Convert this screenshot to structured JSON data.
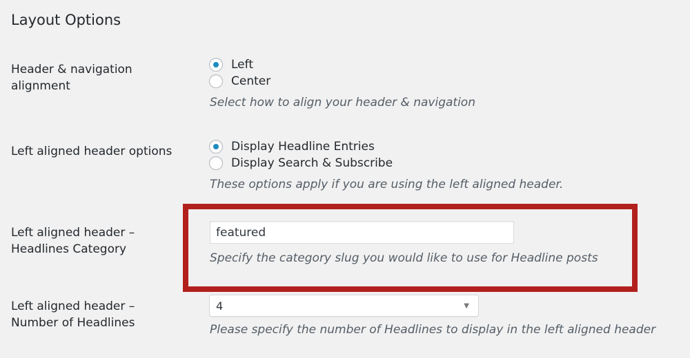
{
  "section": {
    "title": "Layout Options"
  },
  "header_alignment": {
    "label_line1": "Header & navigation",
    "label_line2": "alignment",
    "options": [
      {
        "label": "Left",
        "checked": true
      },
      {
        "label": "Center",
        "checked": false
      }
    ],
    "description": "Select how to align your header & navigation"
  },
  "left_header_options": {
    "label": "Left aligned header options",
    "options": [
      {
        "label": "Display Headline Entries",
        "checked": true
      },
      {
        "label": "Display Search & Subscribe",
        "checked": false
      }
    ],
    "description": "These options apply if you are using the left aligned header."
  },
  "headlines_category": {
    "label_line1": "Left aligned header –",
    "label_line2": "Headlines Category",
    "value": "featured",
    "description": "Specify the category slug you would like to use for Headline posts"
  },
  "number_of_headlines": {
    "label_line1": "Left aligned header –",
    "label_line2": "Number of Headlines",
    "selected": "4",
    "description": "Please specify the number of Headlines to display in the left aligned header"
  },
  "colors": {
    "radio_checked": "#1e8cbe",
    "highlight_border": "#b2201e",
    "background": "#f1f1f1"
  },
  "icons": {
    "select_arrow": "▼"
  }
}
